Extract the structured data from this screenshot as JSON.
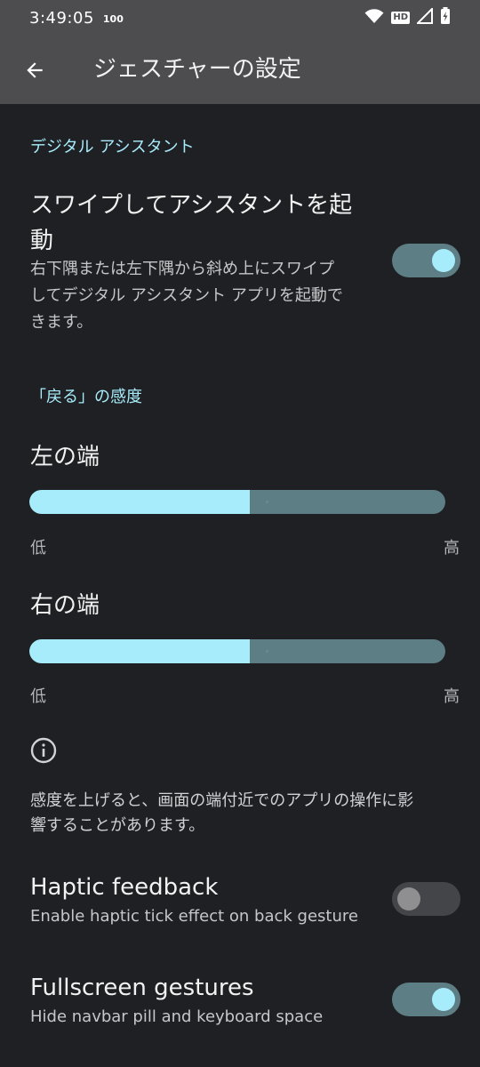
{
  "status_bar": {
    "time": "3:49:05",
    "badge": "100",
    "icons": [
      "wifi-icon",
      "hd-icon",
      "signal-icon",
      "battery-charging-icon"
    ],
    "hd_label": "HD"
  },
  "app_bar": {
    "back_icon": "arrow-back-icon",
    "title": "ジェスチャーの設定"
  },
  "sections": {
    "assistant_header": "デジタル アシスタント",
    "back_header": "「戻る」の感度"
  },
  "assistant_swipe": {
    "title_line1": "スワイプしてアシスタントを起",
    "title_line2": "動",
    "sub_line1": "右下隅または左下隅から斜め上にスワイプ",
    "sub_line2": "してデジタル アシスタント アプリを起動で",
    "sub_line3": "きます。",
    "enabled": true
  },
  "left_edge": {
    "title": "左の端",
    "value_fraction": 0.53,
    "min_label": "低",
    "max_label": "高"
  },
  "right_edge": {
    "title": "右の端",
    "value_fraction": 0.53,
    "min_label": "低",
    "max_label": "高"
  },
  "info": {
    "icon": "info-icon",
    "line1": "感度を上げると、画面の端付近でのアプリの操作に影",
    "line2": "響することがあります。"
  },
  "haptic": {
    "title": "Haptic feedback",
    "subtitle": "Enable haptic tick effect on back gesture",
    "enabled": false
  },
  "fullscreen": {
    "title": "Fullscreen gestures",
    "subtitle": "Hide navbar pill and keyboard space",
    "enabled": true
  },
  "colors": {
    "accent": "#a7ecfb",
    "track": "#5e7e86",
    "background": "#1f2023",
    "header": "#4d4d4f"
  }
}
